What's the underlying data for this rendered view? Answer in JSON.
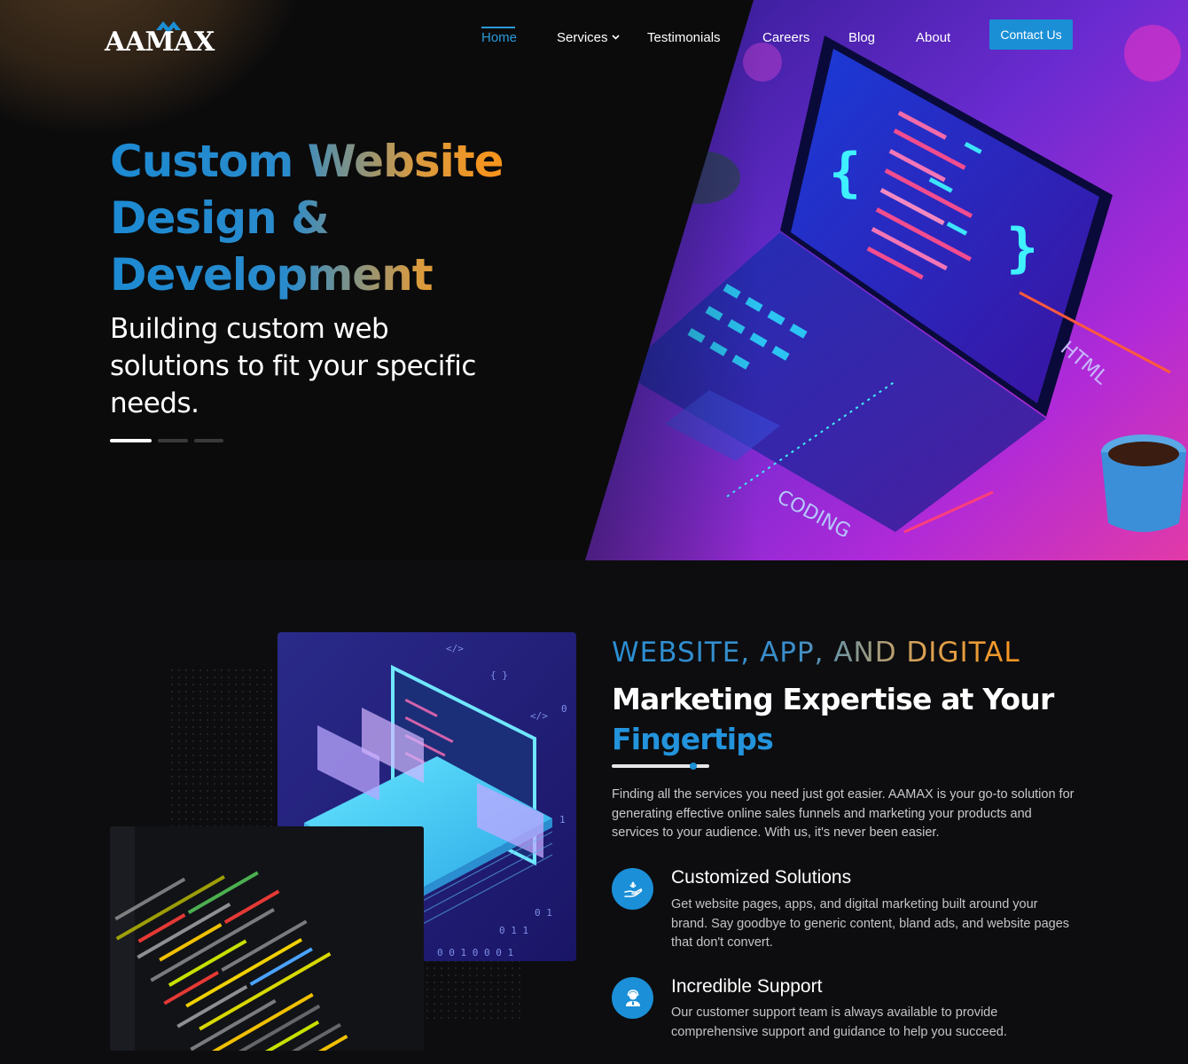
{
  "brand": {
    "logo_text": "AAMAX"
  },
  "nav": {
    "items": [
      {
        "label": "Home",
        "active": true
      },
      {
        "label": "Services",
        "has_dropdown": true
      },
      {
        "label": "Testimonials"
      },
      {
        "label": "Careers"
      },
      {
        "label": "Blog"
      },
      {
        "label": "About"
      }
    ],
    "cta_label": "Contact Us"
  },
  "hero": {
    "title_line1": "Custom Website",
    "title_line2": "Design &",
    "title_line3": "Development",
    "subtitle": "Building custom web solutions to fit your specific needs.",
    "slides_total": 3,
    "slide_active": 1,
    "image_labels": {
      "coding": "CODING",
      "html": "HTML"
    }
  },
  "about": {
    "eyebrow": "WEBSITE, APP, AND DIGITAL",
    "headline_main": "Marketing Expertise at Your",
    "headline_accent": "Fingertips",
    "body": "Finding all the services you need just got easier. AAMAX is your go-to solution for generating effective online sales funnels and marketing your products and services to your audience. With us, it's never been easier.",
    "features": [
      {
        "title": "Customized Solutions",
        "text": "Get website pages, apps, and digital marketing built around your brand. Say goodbye to generic content, bland ads, and website pages that don't convert.",
        "icon": "hand-heart-icon"
      },
      {
        "title": "Incredible Support",
        "text": "Our customer support team is always available to provide comprehensive support and guidance to help you succeed.",
        "icon": "support-agent-icon"
      }
    ]
  },
  "colors": {
    "accent_blue": "#1a8fd6",
    "accent_orange": "#f7941d",
    "background": "#0d0d0f"
  }
}
